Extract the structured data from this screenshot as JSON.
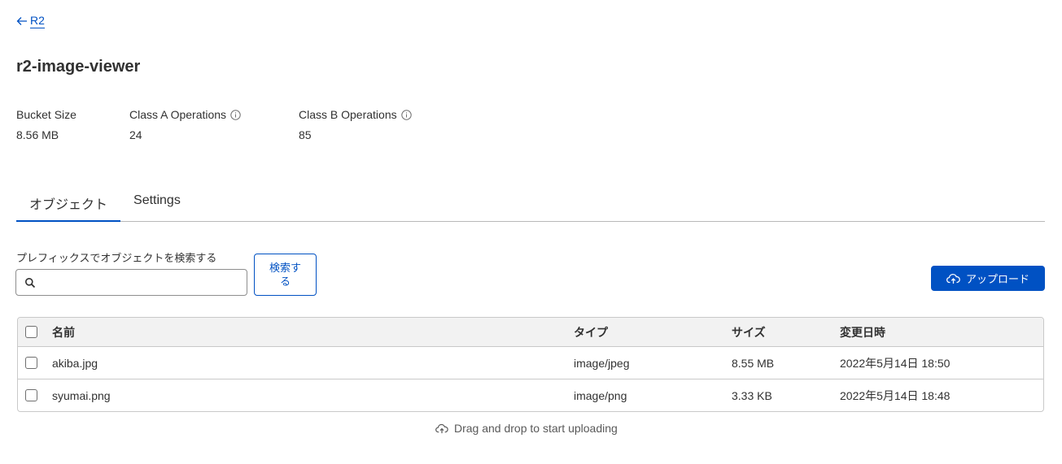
{
  "breadcrumb": {
    "back_label": "R2"
  },
  "page": {
    "title": "r2-image-viewer"
  },
  "stats": {
    "bucket_size": {
      "label": "Bucket Size",
      "value": "8.56 MB"
    },
    "class_a": {
      "label": "Class A Operations",
      "value": "24"
    },
    "class_b": {
      "label": "Class B Operations",
      "value": "85"
    }
  },
  "tabs": [
    {
      "label": "オブジェクト",
      "active": true
    },
    {
      "label": "Settings",
      "active": false
    }
  ],
  "search": {
    "label": "プレフィックスでオブジェクトを検索する",
    "value": "",
    "placeholder": "",
    "button_label_line1": "検索す",
    "button_label_line2": "る"
  },
  "upload": {
    "label": "アップロード"
  },
  "table": {
    "columns": {
      "name": "名前",
      "type": "タイプ",
      "size": "サイズ",
      "date": "変更日時"
    },
    "rows": [
      {
        "name": "akiba.jpg",
        "type": "image/jpeg",
        "size": "8.55 MB",
        "date": "2022年5月14日 18:50"
      },
      {
        "name": "syumai.png",
        "type": "image/png",
        "size": "3.33 KB",
        "date": "2022年5月14日 18:48"
      }
    ]
  },
  "dropzone": {
    "text": "Drag and drop to start uploading"
  },
  "colors": {
    "accent": "#0051c3",
    "border": "#c9c9c9",
    "header_bg": "#f2f2f2"
  }
}
